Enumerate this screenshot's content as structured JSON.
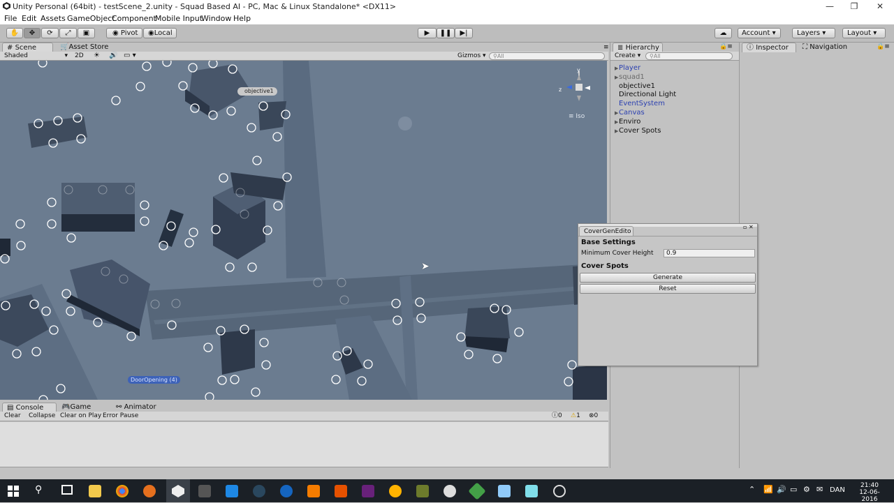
{
  "window": {
    "title": "Unity Personal (64bit) - testScene_2.unity - Squad Based AI - PC, Mac & Linux Standalone* <DX11>",
    "minimize": "—",
    "restore": "❐",
    "close": "✕"
  },
  "menu": [
    "File",
    "Edit",
    "Assets",
    "GameObject",
    "Component",
    "Mobile Input",
    "Window",
    "Help"
  ],
  "toolbar": {
    "pivot": "Pivot",
    "local": "Local",
    "account": "Account",
    "layers": "Layers",
    "layout": "Layout"
  },
  "scene": {
    "tab": "Scene",
    "asset_store_tab": "Asset Store",
    "shading": "Shaded",
    "mode_2d": "2D",
    "gizmos": "Gizmos",
    "search_placeholder": "All",
    "iso_label": "≡ Iso",
    "objective_label": "objective1",
    "door_label": "DoorOpening (4)",
    "axis_y": "y",
    "axis_z": "z"
  },
  "hierarchy": {
    "tab": "Hierarchy",
    "create": "Create",
    "search_placeholder": "All",
    "items": [
      {
        "label": "Player",
        "arrow": "▶",
        "color": "#2a3fb0"
      },
      {
        "label": "squad1",
        "arrow": "▶",
        "color": "#6a6a6a"
      },
      {
        "label": "objective1",
        "arrow": "",
        "color": "#111111"
      },
      {
        "label": "Directional Light",
        "arrow": "",
        "color": "#111111"
      },
      {
        "label": "EventSystem",
        "arrow": "",
        "color": "#2a3fb0"
      },
      {
        "label": "Canvas",
        "arrow": "▶",
        "color": "#2a3fb0"
      },
      {
        "label": "Enviro",
        "arrow": "▶",
        "color": "#111111"
      },
      {
        "label": "Cover Spots",
        "arrow": "▶",
        "color": "#111111"
      }
    ]
  },
  "inspector": {
    "tab": "Inspector",
    "navigation_tab": "Navigation"
  },
  "cover_gen": {
    "title": "CoverGenEdito",
    "base_settings": "Base Settings",
    "min_cover_label": "Minimum Cover Height",
    "min_cover_value": "0.9",
    "cover_spots": "Cover Spots",
    "generate": "Generate",
    "reset": "Reset"
  },
  "console": {
    "tab": "Console",
    "game_tab": "Game",
    "animator_tab": "Animator",
    "clear": "Clear",
    "collapse": "Collapse",
    "clear_on_play": "Clear on Play",
    "error_pause": "Error Pause",
    "info_count": "0",
    "warn_count": "1",
    "error_count": "0"
  },
  "taskbar": {
    "lang": "DAN",
    "time": "21:40",
    "date": "12-06-2016"
  }
}
